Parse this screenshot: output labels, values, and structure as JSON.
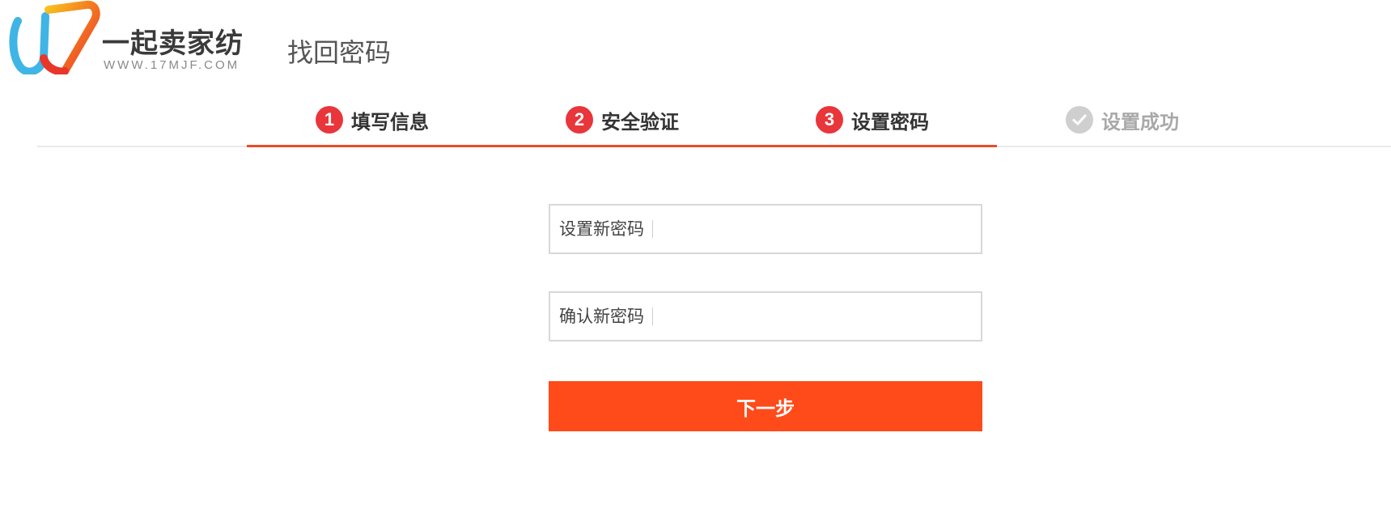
{
  "header": {
    "brand_name": "一起卖家纺",
    "brand_url": "WWW.17MJF.COM",
    "page_title": "找回密码"
  },
  "steps": [
    {
      "number": "1",
      "label": "填写信息",
      "state": "active"
    },
    {
      "number": "2",
      "label": "安全验证",
      "state": "active"
    },
    {
      "number": "3",
      "label": "设置密码",
      "state": "active"
    },
    {
      "number": "",
      "label": "设置成功",
      "state": "pending",
      "icon": "check-icon"
    }
  ],
  "form": {
    "new_password": {
      "label": "设置新密码",
      "value": ""
    },
    "confirm_password": {
      "label": "确认新密码",
      "value": ""
    },
    "next_label": "下一步"
  },
  "colors": {
    "accent": "#ff4a1a",
    "step_badge": "#e8363b",
    "progress_line": "#e94b2a",
    "pending": "#cfcfcf"
  }
}
